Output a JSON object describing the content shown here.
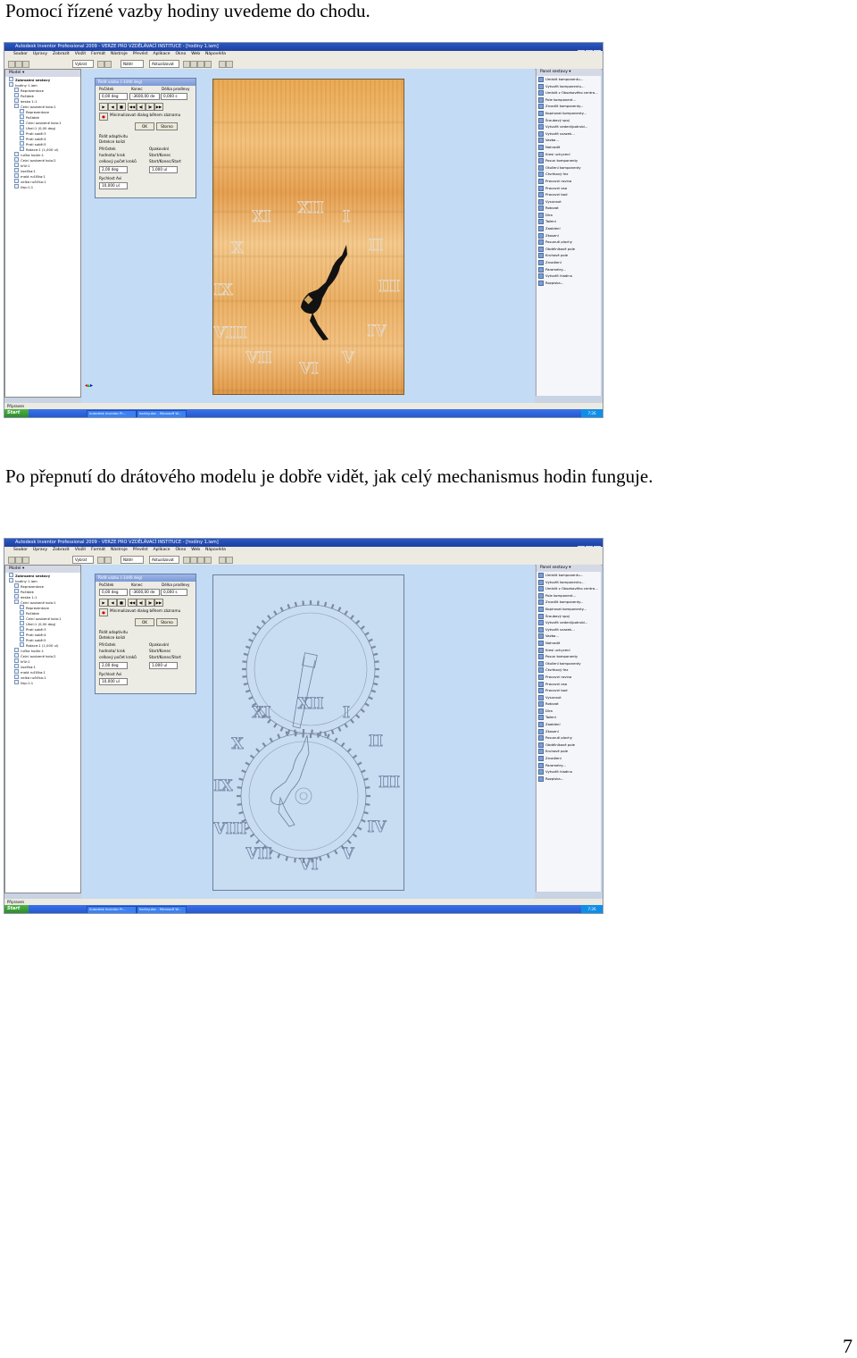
{
  "text": {
    "para1": "Pomocí řízené vazby hodiny uvedeme do chodu.",
    "para2": "Po přepnutí do drátového modelu je dobře vidět, jak celý mechanismus hodin funguje.",
    "page_number": "7"
  },
  "screenshot": {
    "window_title": "Autodesk Inventor Professional 2009 - VERZE PRO VZDĚLÁVACÍ INSTITUCE - [hodiny 1.iam]",
    "menu": [
      "Soubor",
      "Úpravy",
      "Zobrazit",
      "Vložit",
      "Formát",
      "Nástroje",
      "Převést",
      "Aplikace",
      "Okno",
      "Web",
      "Nápověda"
    ],
    "toolbar": {
      "appearance": "Vybrat",
      "color": "Nátěr",
      "update": "Aktualizovat"
    },
    "browser": {
      "title": "Model ▾",
      "view_label": "Zobrazení sestavy",
      "items": [
        "hodiny 1.iam",
        "Reprezentace",
        "Počátek",
        "deska 1:1",
        "Čelní ozubené kolo:1",
        "Reprezentace",
        "Počátek",
        "Čelní ozubené kolo:1",
        "Úhel:1 (0,00 deg)",
        "Proti sobě:3",
        "Proti sobě:4",
        "Proti sobě:5",
        "Rotace:1 (1,000 ul)",
        "ručka hodin:1",
        "Čelní ozubené kolo:2",
        "kříž:1",
        "úsečka:1",
        "malá ručička:1",
        "velká ručička:1",
        "čep:1:1"
      ]
    },
    "dialog": {
      "title": "Řídit vazbu  (-1440 deg)",
      "col1": "Počátek",
      "col2": "Konec",
      "col3": "Délka prodlevy",
      "start_val": "0,00 deg",
      "end_val": "-3600,00 de",
      "pause_val": "0,000 s",
      "minimize": "Minimalizovat dialog během záznamu",
      "ok": "OK",
      "cancel": "Storno",
      "adaptive": "Řídit adaptivitu",
      "collision": "Detekce kolizí",
      "increment_label": "Přírůstek",
      "increment_opt1": "hodnota/ krok",
      "increment_opt2": "celkový počet kroků",
      "increment_val": "2,00 deg",
      "repeat_label": "Opakování",
      "repeat_opt1": "Start/Konec",
      "repeat_opt2": "Start/Konec/Start",
      "repeat_val": "1,000 ul",
      "avi_label": "Rychlost Avi",
      "avi_val": "10,000 ul"
    },
    "panel": {
      "title": "Panel sestavy ▾",
      "items": [
        "Umístit komponentu...",
        "Vytvořit komponentu...",
        "Umístit z Obsahového centra...",
        "Pole komponent...",
        "Zrcadlit komponenty...",
        "Kopírovat komponenty...",
        "Šroubový spoj",
        "Vytvořit vedení/potrubí...",
        "Vytvořit svazek...",
        "Vazba...",
        "Nahradit",
        "Kresl uchycení",
        "Posun komponenty",
        "Otočení komponenty",
        "Čtvrtkový řez",
        "Pracovní rovina",
        "Pracovní osa",
        "Pracovní bod",
        "Vysunout",
        "Rotovat",
        "Díra",
        "Tažení",
        "Zaoblení",
        "Zkosení",
        "Posunutí plochy",
        "Obdélníkové pole",
        "Kruhové pole",
        "Zrcadlení",
        "Parametry...",
        "Vytvořit hladinu",
        "Rozpiska..."
      ]
    },
    "status": "Připraven",
    "taskbar": {
      "start": "Start",
      "task1": "Autodesk Inventor Pr...",
      "task2": "hodiny.doc - Microsoft W..."
    },
    "roman": [
      "XII",
      "I",
      "II",
      "III",
      "IV",
      "V",
      "VI",
      "VII",
      "VIII",
      "IX",
      "X",
      "XI"
    ]
  },
  "colors": {
    "viewport": "#c3dbf4",
    "wood": "#e9ae5f",
    "hand": "#111111",
    "wire": "#6f7f96"
  }
}
